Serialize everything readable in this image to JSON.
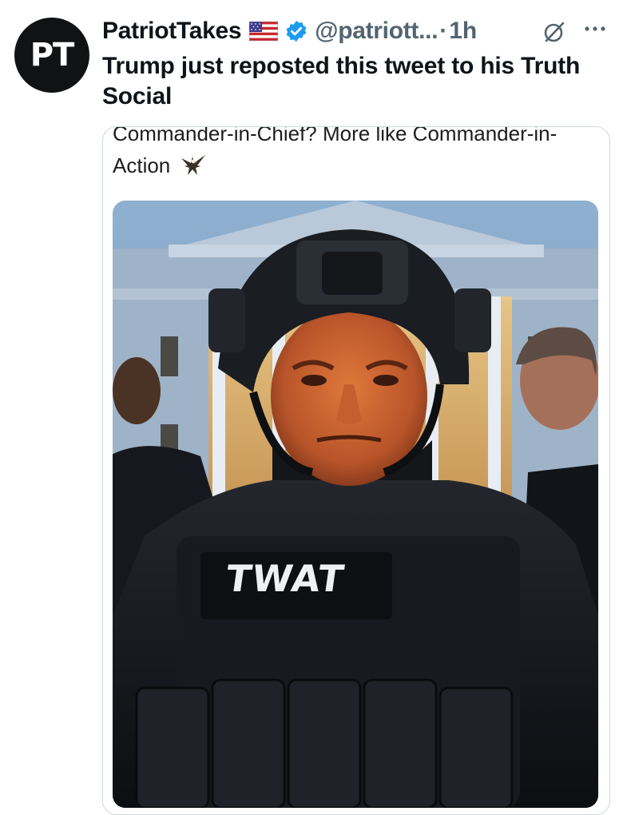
{
  "author": {
    "avatar_initials": "PT",
    "display_name": "PatriotTakes",
    "handle": "@patriott...",
    "separator": "·",
    "timestamp": "1h"
  },
  "icons": {
    "flag": "us-flag-icon",
    "verified": "verified-badge-icon",
    "grok": "grok-icon",
    "more": "more-icon",
    "eagle": "eagle-icon"
  },
  "tweet": {
    "text": "Trump just reposted this tweet to his Truth Social"
  },
  "quoted": {
    "text": "Commander-in-Chief? More like Commander-in-Action",
    "image": {
      "vest_text": "TWAT"
    }
  },
  "colors": {
    "verified_blue": "#1d9bf0",
    "secondary_text": "#536471"
  }
}
